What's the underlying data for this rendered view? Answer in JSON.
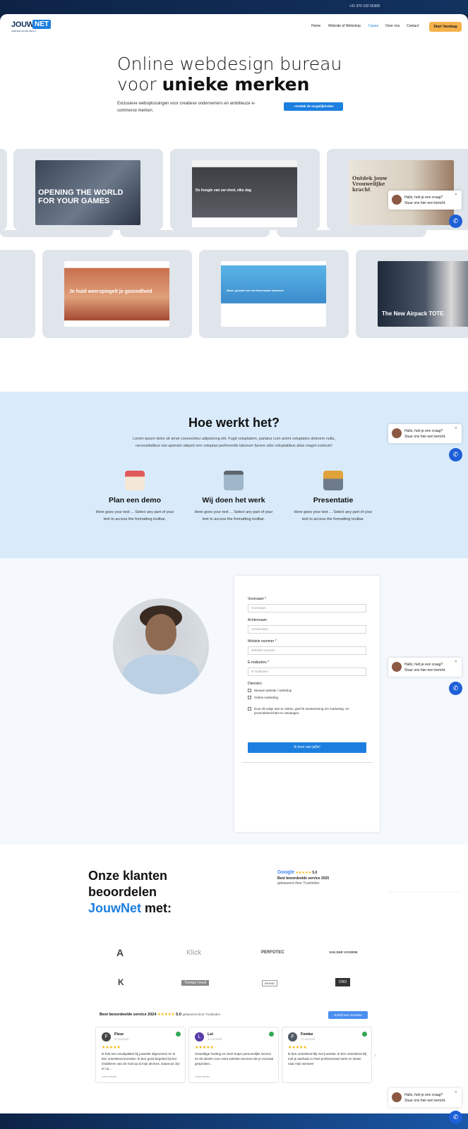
{
  "topbar": {
    "phone": "+31 970 102 55308"
  },
  "logo": {
    "word1": "JOUW",
    "word2": "NET",
    "tagline": "WEBDESIGNBUREAU"
  },
  "nav": {
    "items": [
      "Home",
      "Website of Webshop",
      "Cases",
      "Over ons",
      "Contact"
    ],
    "active": "Cases",
    "cta": "Start Vandaag"
  },
  "hero": {
    "title_line1": "Online webdesign bureau",
    "title_line2_prefix": "voor ",
    "title_line2_bold": "unieke merken",
    "subtitle": "Exclusieve weboplossingen voor creatieve ondernemers en ambitieuze e-commerce merken.",
    "button": "› Ontdek de mogelijkheden"
  },
  "gallery": {
    "shot1_title": "OPENING THE WORLD FOR YOUR GAMES",
    "shot2_title": "De hoogte van uw vloot, elke dag",
    "shot3_title": "Ontdek jouw Vrouwelijke kracht",
    "shot4_title": "Je huid weerspiegelt je gezondheid",
    "shot5_title": "Mooie, gezonde tuin met Nederlandse tuinkracht",
    "shot6_title": "The New Airpack TOTE"
  },
  "how": {
    "title": "Hoe werkt het?",
    "lorem": "Lorem ipsum dolor sit amet consectetur adipisicing elit. Fugit voluptatem, pariatur cum animi voluptates dolorem nulla, necessitatibus nisi aperiam aliquid rem voluptas perferendis laborum facere odio voluptatibus alias magni nostrum!",
    "steps": [
      {
        "title": "Plan een demo",
        "desc": "Here goes your text ... Select any part of your text to access the formatting toolbar."
      },
      {
        "title": "Wij doen het werk",
        "desc": "Here goes your text ... Select any part of your text to access the formatting toolbar."
      },
      {
        "title": "Presentatie",
        "desc": "Here goes your text ... Select any part of your text to access the formatting toolbar."
      }
    ]
  },
  "form": {
    "first_name_label": "Voornaam *",
    "first_name_placeholder": "Voornaam",
    "last_name_label": "Achternaam",
    "last_name_placeholder": "Achternaam",
    "mobile_label": "Mobiele nummer *",
    "mobile_placeholder": "Mobiele nummer",
    "email_label": "E-mailadres *",
    "email_placeholder": "E-mailadres",
    "services_label": "Diensten",
    "service1": "Nieuwe website / webshop",
    "service2": "Online marketing",
    "consent": "Door dit vakje aan te vinken, geef ik toestemming om marketing- en promotieberichten te ontvangen.",
    "submit": "Ik hoor van jullie!"
  },
  "reviews": {
    "title1": "Onze klanten",
    "title2": "beoordelen",
    "title3_blue": "JouwNet",
    "title3_rest": " met:",
    "google_word": "Google",
    "google_score": "5.0",
    "google_best": "Best beoordeelde service 2025",
    "google_by": "gebaseerd door Trustindex",
    "clients": [
      "A",
      "Klick",
      "PERFOTEC",
      "VAN DER VOORDE",
      "K",
      "Trompe l'oeuil",
      "BRAND",
      "CRO"
    ],
    "best_line": "Best beoordeelde service 2024",
    "best_score": "5.0",
    "best_by": "gebaseerd door Trustindex",
    "write_button": "Schrijf een recensie",
    "cards": [
      {
        "initial": "F",
        "name": "Fleur",
        "date": "17.03.2023",
        "text": "Ik heb een emailpakket bij jouwNet afgenomen en ik ben ontzettend tevreden. Ik ben goed begeleid bij het installeren van de mail op al mijn devices. Daarvoor zijn er nu...",
        "more": "Lees verder"
      },
      {
        "initial": "L",
        "name": "Lei",
        "date": "17.03.2023",
        "text": "Geweldige hosting en snel! Super persoonlijke service en de ideeën voor extra website-services die je normaal gesproken...",
        "more": "Lees verder"
      },
      {
        "initial": "F",
        "name": "Femke",
        "date": "17.03.2023",
        "text": "Ik ben ontzettend blij met jouwNet. Ik ben ontzettend blij met je aanhadt zo heel professioneel werk en luister naar mijn wensen!",
        "more": ""
      }
    ]
  },
  "chat": {
    "line1": "Hallo, heb je een vraag?",
    "line2": "Stuur ons hier een bericht."
  },
  "colors": {
    "accent": "#1c7fe0",
    "cta": "#f5b14a",
    "navy": "#0f2c55",
    "how_bg": "#d9ebfb"
  }
}
